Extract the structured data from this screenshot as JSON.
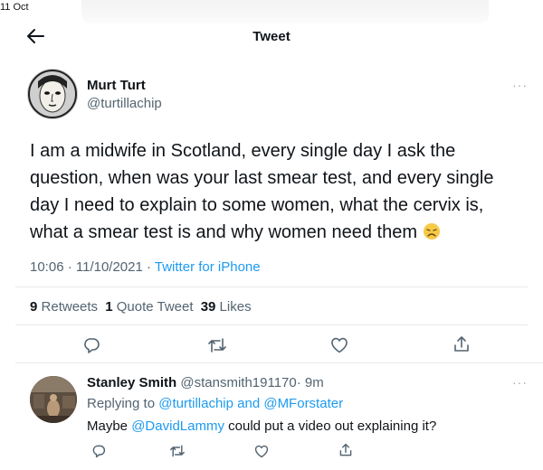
{
  "status_bar": {
    "date": "11 Oct"
  },
  "header": {
    "title": "Tweet"
  },
  "tweet": {
    "author_name": "Murt Turt",
    "author_handle": "@turtillachip",
    "text": "I am a midwife in Scotland, every single day I ask the question, when was your last smear test, and every single day I need to explain to some women, what the cervix is, what a smear test is and why women need them",
    "emoji": "disappointed-face",
    "time": "10:06 · 11/10/2021 · ",
    "source": "Twitter for iPhone",
    "retweets_count": "9",
    "retweets_label": "Retweets",
    "quotes_count": "1",
    "quotes_label": "Quote Tweet",
    "likes_count": "39",
    "likes_label": "Likes",
    "more": "···"
  },
  "reply": {
    "author_name": "Stanley Smith",
    "author_handle": "@stansmith191170",
    "age": "· 9m",
    "replying_prefix": "Replying to ",
    "replying_to": "@turtillachip and @MForstater",
    "text_mention": "@DavidLammy",
    "text_rest": " could put a video out explaining it?",
    "more": "···"
  },
  "colors": {
    "accent": "#1d9bf0",
    "muted": "#536471",
    "text": "#0f1419"
  },
  "icons": [
    "back-arrow-icon",
    "reply-icon",
    "retweet-icon",
    "like-icon",
    "share-icon"
  ]
}
